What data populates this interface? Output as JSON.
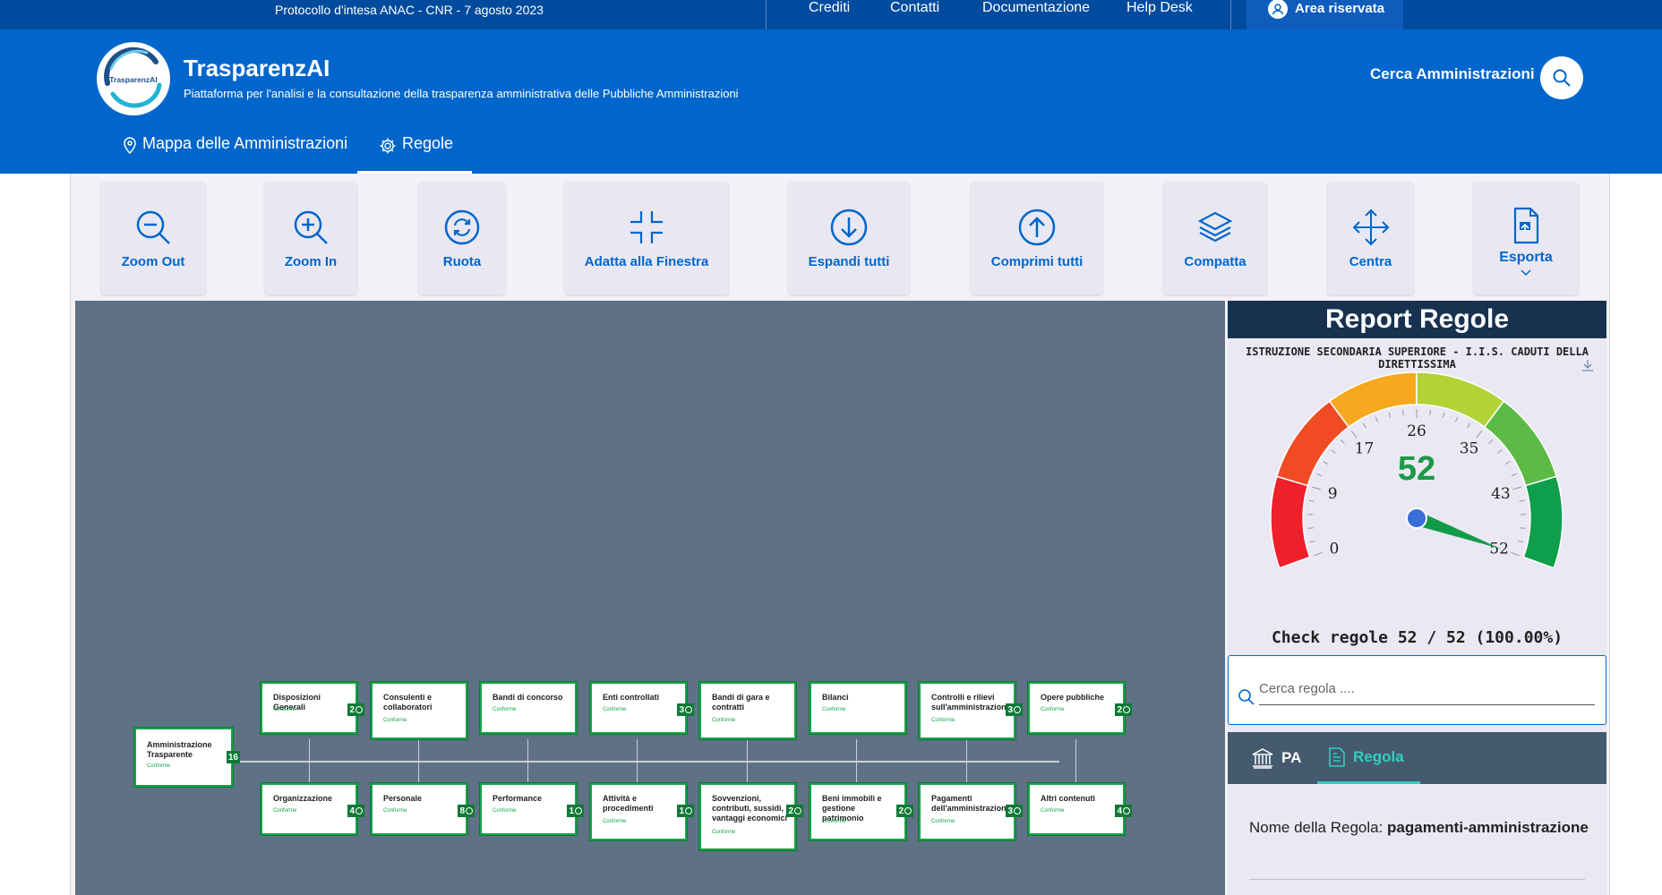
{
  "topbar": {
    "protocol": "Protocollo d'intesa ANAC - CNR - 7 agosto 2023",
    "links": [
      "Crediti",
      "Contatti",
      "Documentazione",
      "Help Desk"
    ],
    "area_riservata": "Area riservata"
  },
  "header": {
    "logo_text": "TrasparenzAI",
    "title": "TrasparenzAI",
    "subtitle": "Piattaforma per l'analisi e la consultazione della trasparenza amministrativa delle Pubbliche Amministrazioni",
    "search_label": "Cerca Amministrazioni",
    "nav": [
      {
        "label": "Mappa delle Amministrazioni",
        "icon": "map-pin-icon"
      },
      {
        "label": "Regole",
        "icon": "gear-icon"
      }
    ]
  },
  "toolbar": {
    "buttons": [
      {
        "label": "Zoom Out",
        "icon": "zoom-out-icon"
      },
      {
        "label": "Zoom In",
        "icon": "zoom-in-icon"
      },
      {
        "label": "Ruota",
        "icon": "rotate-icon"
      },
      {
        "label": "Adatta alla Finestra",
        "icon": "fit-window-icon"
      },
      {
        "label": "Espandi tutti",
        "icon": "expand-all-icon"
      },
      {
        "label": "Comprimi tutti",
        "icon": "collapse-all-icon"
      },
      {
        "label": "Compatta",
        "icon": "layers-icon"
      },
      {
        "label": "Centra",
        "icon": "center-move-icon"
      },
      {
        "label": "Esporta",
        "icon": "export-file-icon"
      }
    ]
  },
  "tree": {
    "root": {
      "title": "Amministrazione Trasparente",
      "status": "Conforme",
      "count": "16"
    },
    "top": [
      {
        "title": "Disposizioni Generali",
        "status": "Conforme",
        "count": "2"
      },
      {
        "title": "Consulenti e collaboratori",
        "status": "Conforme",
        "count": ""
      },
      {
        "title": "Bandi di concorso",
        "status": "Conforme",
        "count": ""
      },
      {
        "title": "Enti controllati",
        "status": "Conforme",
        "count": "3"
      },
      {
        "title": "Bandi di gara e contratti",
        "status": "Conforme",
        "count": ""
      },
      {
        "title": "Bilanci",
        "status": "Conforme",
        "count": ""
      },
      {
        "title": "Controlli e rilievi sull'amministrazione",
        "status": "Conforme",
        "count": "3"
      },
      {
        "title": "Opere pubbliche",
        "status": "Conforme",
        "count": "2"
      }
    ],
    "bottom": [
      {
        "title": "Organizzazione",
        "status": "Conforme",
        "count": "4"
      },
      {
        "title": "Personale",
        "status": "Conforme",
        "count": "8"
      },
      {
        "title": "Performance",
        "status": "Conforme",
        "count": "1"
      },
      {
        "title": "Attività e procedimenti",
        "status": "Conforme",
        "count": "1"
      },
      {
        "title": "Sovvenzioni, contributi, sussidi, vantaggi economici",
        "status": "Conforme",
        "count": "2"
      },
      {
        "title": "Beni immobili e gestione patrimonio",
        "status": "Conforme",
        "count": "2"
      },
      {
        "title": "Pagamenti dell'amministrazione",
        "status": "Conforme",
        "count": "3"
      },
      {
        "title": "Altri contenuti",
        "status": "Conforme",
        "count": "4"
      }
    ]
  },
  "report": {
    "title": "Report Regole",
    "pa_name": "ISTRUZIONE SECONDARIA SUPERIORE - I.I.S. CADUTI DELLA DIRETTISSIMA",
    "gauge": {
      "value": "52",
      "value_num": 52,
      "max": 52,
      "ticks": [
        "0",
        "9",
        "17",
        "26",
        "35",
        "43",
        "52"
      ],
      "colors": [
        "#ef1f2b",
        "#f04b23",
        "#f6a81f",
        "#b2d235",
        "#5cba47",
        "#0f9e4b"
      ]
    },
    "check_text": "Check regole 52 / 52 (100.00%)",
    "search_placeholder": "Cerca regola ....",
    "tabs": [
      "PA",
      "Regola"
    ],
    "rule_label": "Nome della Regola:",
    "rule_value": "pagamenti-amministrazione"
  }
}
